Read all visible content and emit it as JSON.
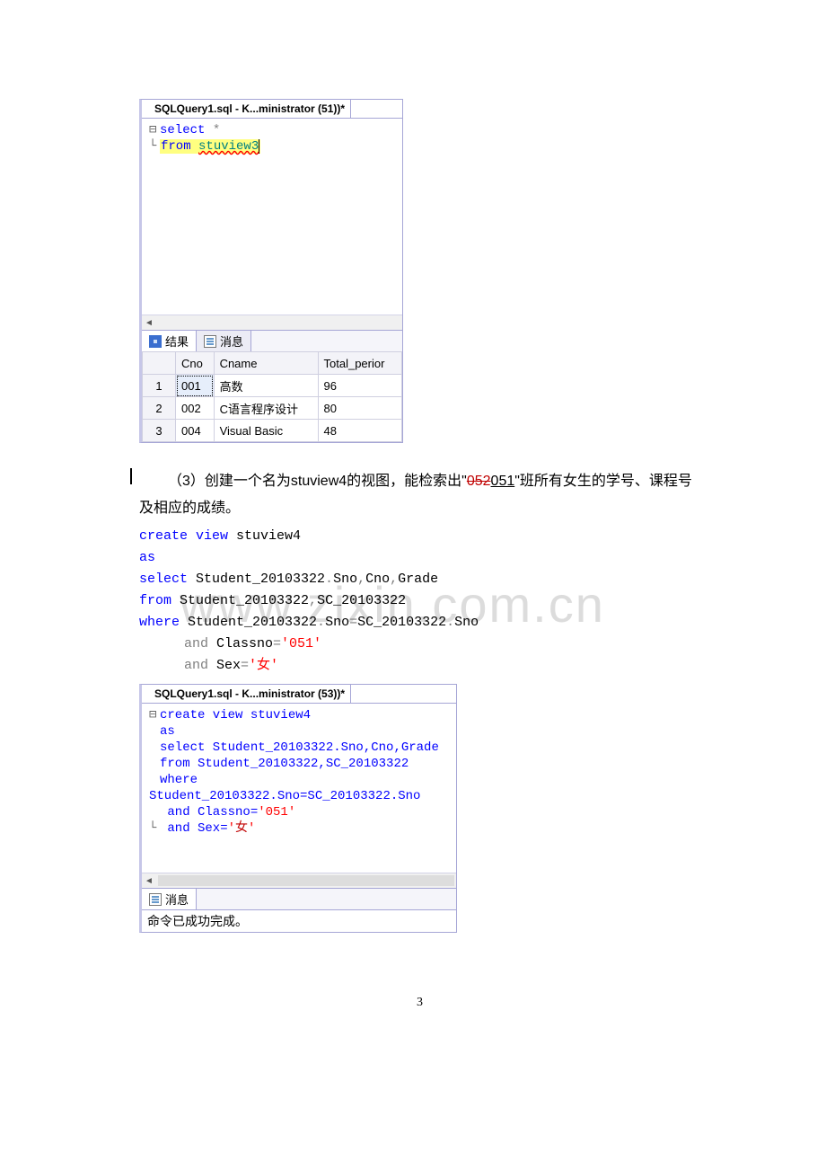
{
  "watermark": "www.zixin.com.cn",
  "window1": {
    "tab_title": "SQLQuery1.sql - K...ministrator (51))*",
    "code_line1_kw": "select",
    "code_line1_star": " *",
    "code_line2_from": "from ",
    "code_line2_view": "stuview3",
    "tab_results": "结果",
    "tab_messages": "消息",
    "headers": [
      "",
      "Cno",
      "Cname",
      "Total_perior"
    ],
    "rows": [
      [
        "1",
        "001",
        "高数",
        "96"
      ],
      [
        "2",
        "002",
        "C语言程序设计",
        "80"
      ],
      [
        "3",
        "004",
        "Visual Basic",
        "48"
      ]
    ]
  },
  "paragraph": {
    "prefix": "（3）创建一个名为stuview4的视图，能检索出\"",
    "strikethrough": "052",
    "underline": "051",
    "suffix": "\"班所有女生的学号、课程号及相应的成绩。"
  },
  "sql_block": {
    "l1a": "create",
    "l1b": " view",
    "l1c": " stuview4",
    "l2": "as",
    "l3a": "select",
    "l3b": " Student_20103322",
    "l3c": ".",
    "l3d": "Sno",
    "l3e": ",",
    "l3f": "Cno",
    "l3g": ",",
    "l3h": "Grade",
    "l4a": "from",
    "l4b": " Student_20103322",
    "l4c": ",",
    "l4d": "SC_20103322",
    "l5a": "where",
    "l5b": " Student_20103322",
    "l5c": ".",
    "l5d": "Sno",
    "l5e": "=",
    "l5f": "SC_20103322",
    "l5g": ".",
    "l5h": "Sno",
    "l6a": "and",
    "l6b": " Classno",
    "l6c": "=",
    "l6d": "'051'",
    "l7a": "and",
    "l7b": " Sex",
    "l7c": "=",
    "l7d": "'女'"
  },
  "window2": {
    "tab_title": "SQLQuery1.sql - K...ministrator (53))*",
    "l1": "create view stuview4",
    "l2": "as",
    "l3": "select Student_20103322.Sno,Cno,Grade",
    "l4": "from Student_20103322,SC_20103322",
    "l5": "where Student_20103322.Sno=SC_20103322.Sno",
    "l6_indent": "      and Classno=",
    "l6_lit": "'051'",
    "l7_indent": "      and Sex=",
    "l7_lit_open": "'",
    "l7_lit_cn": "女",
    "l7_lit_close": "'",
    "tab_messages": "消息",
    "msg": "命令已成功完成。"
  },
  "page_number": "3"
}
